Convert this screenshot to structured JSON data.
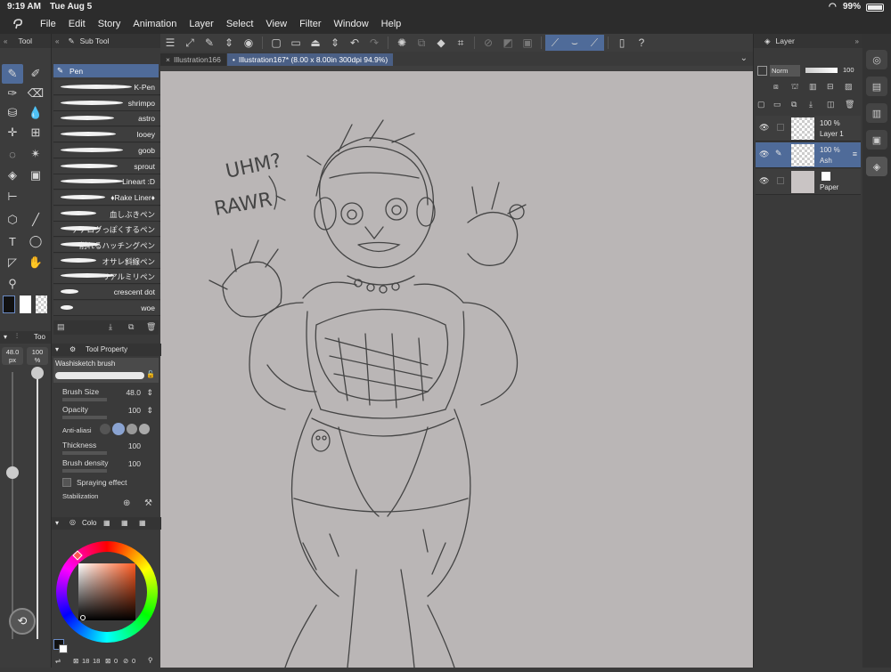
{
  "status": {
    "time": "9:19 AM",
    "date": "Tue Aug 5",
    "battery": "99%"
  },
  "menu": [
    "File",
    "Edit",
    "Story",
    "Animation",
    "Layer",
    "Select",
    "View",
    "Filter",
    "Window",
    "Help"
  ],
  "tabs": {
    "inactive": "Illustration166",
    "active": "Illustration167* (8.00 x 8.00in 300dpi 94.9%)"
  },
  "tool_panel": {
    "title": "Tool"
  },
  "subtool_panel": {
    "title": "Sub Tool",
    "group": "Pen",
    "brushes": [
      "K-Pen",
      "shrimpo",
      "astro",
      "looey",
      "goob",
      "sprout",
      "Lineart :D",
      "♦Rake Liner♦",
      "血しぶきペン",
      "アナログっぽくするペン",
      "削れるハッチングペン",
      "オサレ斜線ペン",
      "リアルミリペン",
      "crescent dot",
      "woe"
    ]
  },
  "size_slider": {
    "title": "Too",
    "size": "48.0",
    "size_unit": "px",
    "opacity": "100",
    "opacity_unit": "%"
  },
  "tool_property": {
    "title": "Tool Property",
    "brush_name": "Washisketch brush",
    "brush_size_label": "Brush Size",
    "brush_size": "48.0",
    "opacity_label": "Opacity",
    "opacity": "100",
    "antialias_label": "Anti-aliasi",
    "thickness_label": "Thickness",
    "thickness": "100",
    "density_label": "Brush density",
    "density": "100",
    "spraying_label": "Spraying effect",
    "stabilization_label": "Stabilization"
  },
  "color_panel": {
    "title": "Colo",
    "counter1": "18",
    "counter2": "18",
    "counter3": "0",
    "counter4": "0"
  },
  "layer_panel": {
    "title": "Layer",
    "blend": "Norm",
    "opacity": "100",
    "layers": [
      {
        "opacity": "100 %",
        "name": "Layer 1"
      },
      {
        "opacity": "100 %",
        "name": "Ash"
      },
      {
        "opacity": "",
        "name": "Paper"
      }
    ]
  },
  "sketch_text": {
    "line1": "UHM?",
    "line2": "RAWR"
  },
  "colors": {
    "accent": "#4f6b99",
    "paper": "#bab6b6",
    "ink": "#444444"
  }
}
